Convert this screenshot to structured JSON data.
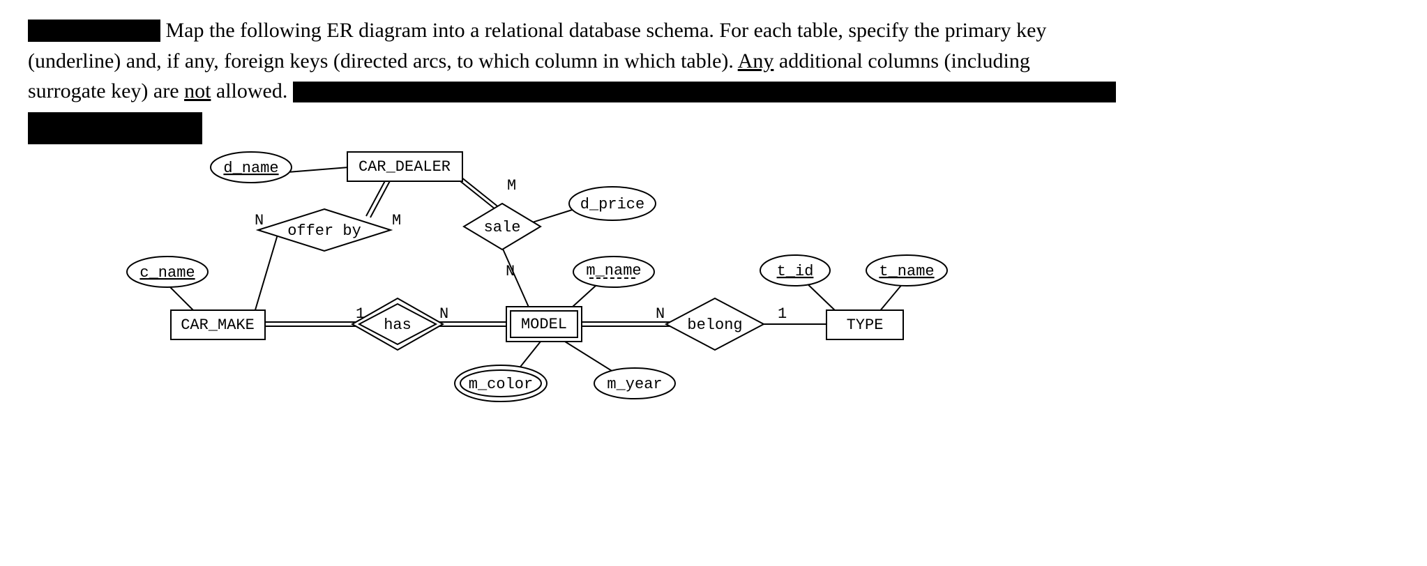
{
  "question": {
    "line1_after_redact": "Map the following ER diagram into a relational database schema.  For each table, specify the primary key",
    "line2_pre": "(underline) and, if any, foreign keys (directed arcs, to which column in which table).  ",
    "line2_any": "Any",
    "line2_post": " additional columns (including",
    "line3_pre": "surrogate key) are ",
    "line3_not": "not",
    "line3_post": " allowed. "
  },
  "entities": {
    "car_dealer": "CAR_DEALER",
    "car_make": "CAR_MAKE",
    "model": "MODEL",
    "type": "TYPE"
  },
  "relationships": {
    "offer_by": "offer by",
    "sale": "sale",
    "has": "has",
    "belong": "belong"
  },
  "attributes": {
    "d_name": "d_name",
    "c_name": "c_name",
    "d_price": "d_price",
    "m_name": "m_name",
    "m_color": "m_color",
    "m_year": "m_year",
    "t_id": "t_id",
    "t_name": "t_name"
  },
  "cardinalities": {
    "offer_by_car_make": "N",
    "offer_by_car_dealer": "M",
    "sale_car_dealer": "M",
    "sale_model": "N",
    "has_car_make": "1",
    "has_model": "N",
    "belong_model": "N",
    "belong_type": "1"
  },
  "diagram_meta": {
    "weak_entity": "MODEL",
    "identifying_relationship": "has",
    "key_attributes": [
      "d_name",
      "c_name",
      "t_id",
      "t_name"
    ],
    "partial_key_attributes": [
      "m_name"
    ],
    "multivalued_attributes": [
      "m_color"
    ]
  }
}
